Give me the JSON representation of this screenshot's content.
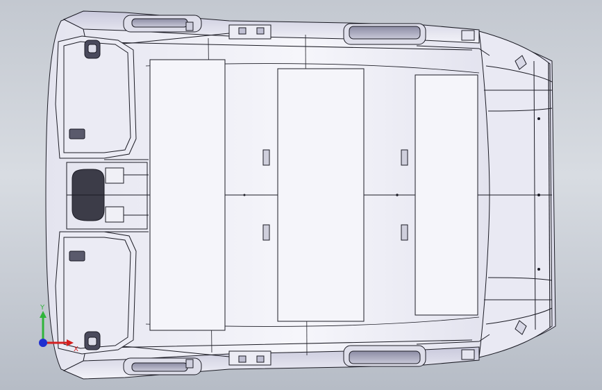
{
  "viewport": {
    "background_top": "#c3c8d0",
    "background_bottom": "#b6bcc6",
    "part_fill": "#f1f1f7",
    "part_shade": "#d6d6e4",
    "edge_color": "#1b1b24"
  },
  "triad": {
    "y_label": "Y",
    "x_label": "X",
    "y_color": "#2fb43a",
    "x_color": "#d42020",
    "z_color": "#1f2fd0"
  }
}
